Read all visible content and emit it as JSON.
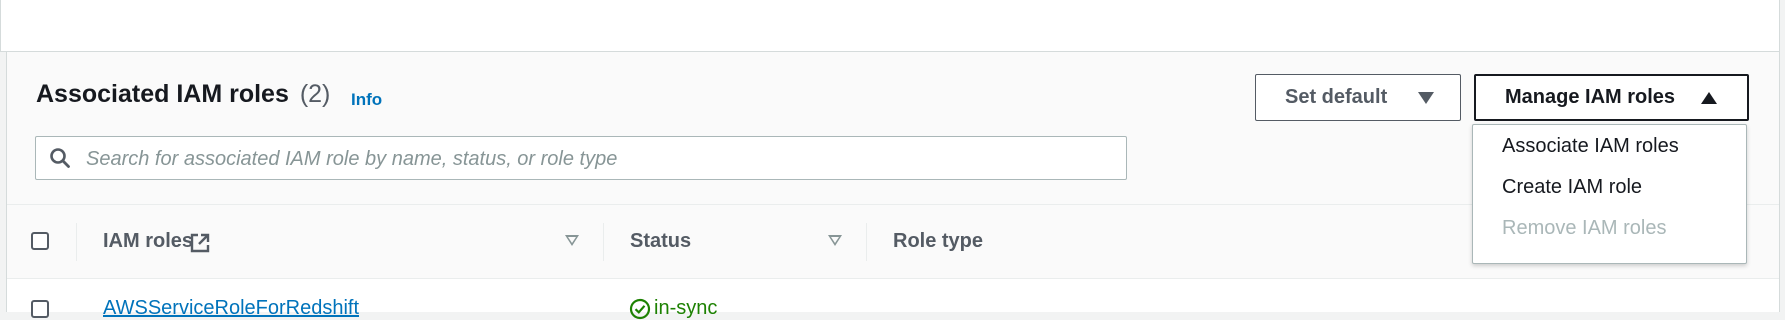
{
  "panel": {
    "title": "Associated IAM roles",
    "count": "(2)",
    "info_label": "Info",
    "search_placeholder": "Search for associated IAM role by name, status, or role type"
  },
  "actions": {
    "set_default_label": "Set default",
    "manage_label": "Manage IAM roles"
  },
  "dropdown_menu": [
    {
      "label": "Associate IAM roles",
      "disabled": false
    },
    {
      "label": "Create IAM role",
      "disabled": false
    },
    {
      "label": "Remove IAM roles",
      "disabled": true
    }
  ],
  "table": {
    "columns": [
      "IAM roles",
      "Status",
      "Role type"
    ],
    "rows": [
      {
        "name": "AWSServiceRoleForRedshift",
        "status": "in-sync",
        "role_type": ""
      }
    ]
  },
  "icons": {
    "search": "search-icon",
    "external_link": "external-link-icon",
    "status_ok": "check-circle-icon",
    "sort": "sort-triangle-icon",
    "caret_down": "caret-down-icon",
    "caret_up": "caret-up-icon"
  },
  "colors": {
    "link": "#0073bb",
    "success": "#1d8102",
    "text_primary": "#16191f",
    "text_secondary": "#545b64",
    "disabled": "#aab7b8"
  }
}
